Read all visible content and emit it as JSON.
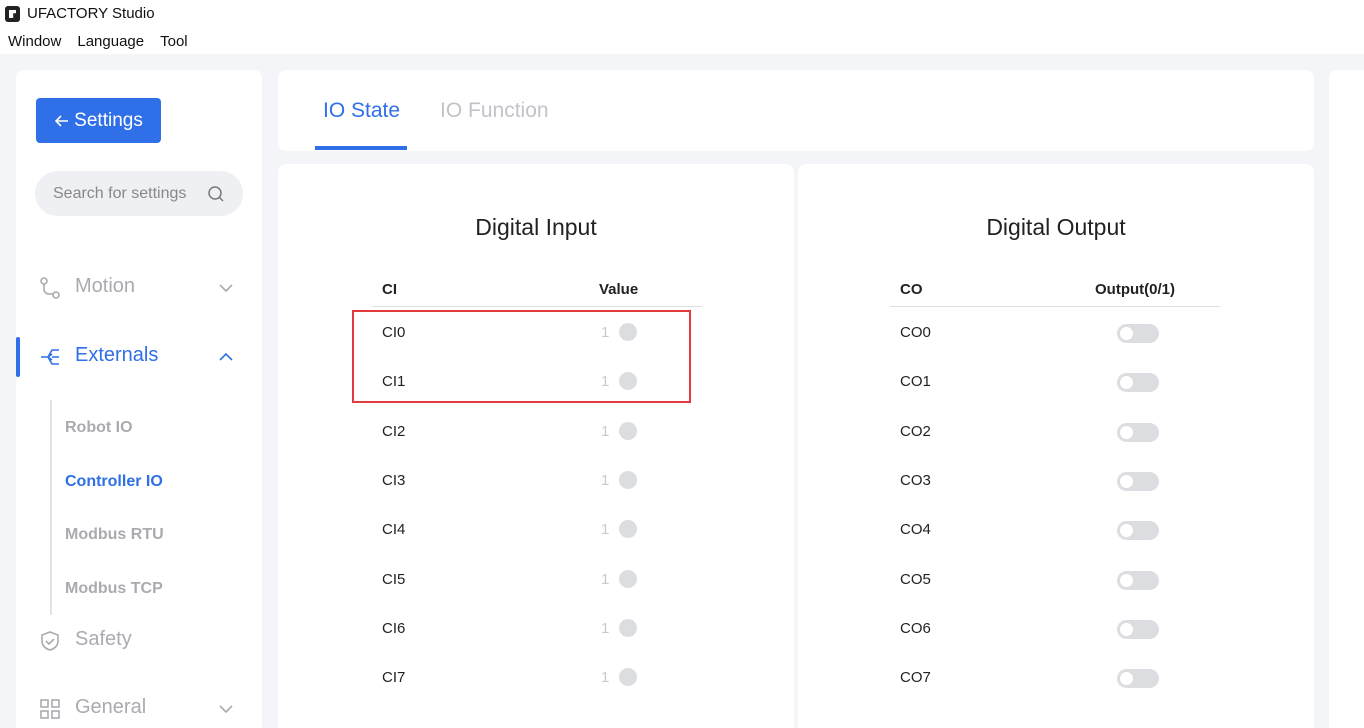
{
  "app": {
    "title": "UFACTORY Studio"
  },
  "menu": [
    "Window",
    "Language",
    "Tool"
  ],
  "sidebar": {
    "back_label": "Settings",
    "search_placeholder": "Search for settings",
    "items": [
      {
        "label": "Motion",
        "icon": "motion-icon"
      },
      {
        "label": "Externals",
        "icon": "externals-icon"
      },
      {
        "label": "Safety",
        "icon": "shield-icon"
      },
      {
        "label": "General",
        "icon": "grid-icon"
      }
    ],
    "sub_items": [
      "Robot IO",
      "Controller IO",
      "Modbus RTU",
      "Modbus TCP"
    ],
    "active_item": "Externals",
    "active_sub_item": "Controller IO"
  },
  "tabs": [
    "IO State",
    "IO Function"
  ],
  "active_tab": "IO State",
  "digital_input": {
    "title": "Digital Input",
    "headers": [
      "CI",
      "Value"
    ],
    "rows": [
      {
        "name": "CI0",
        "value": "1"
      },
      {
        "name": "CI1",
        "value": "1"
      },
      {
        "name": "CI2",
        "value": "1"
      },
      {
        "name": "CI3",
        "value": "1"
      },
      {
        "name": "CI4",
        "value": "1"
      },
      {
        "name": "CI5",
        "value": "1"
      },
      {
        "name": "CI6",
        "value": "1"
      },
      {
        "name": "CI7",
        "value": "1"
      }
    ]
  },
  "digital_output": {
    "title": "Digital Output",
    "headers": [
      "CO",
      "Output(0/1)"
    ],
    "rows": [
      {
        "name": "CO0",
        "on": false
      },
      {
        "name": "CO1",
        "on": false
      },
      {
        "name": "CO2",
        "on": false
      },
      {
        "name": "CO3",
        "on": false
      },
      {
        "name": "CO4",
        "on": false
      },
      {
        "name": "CO5",
        "on": false
      },
      {
        "name": "CO6",
        "on": false
      },
      {
        "name": "CO7",
        "on": false
      }
    ]
  },
  "colors": {
    "accent": "#2f6fe8",
    "highlight": "#e0393e"
  }
}
